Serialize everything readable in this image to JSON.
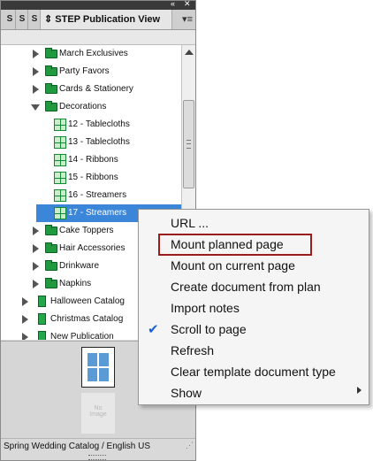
{
  "panel": {
    "mini_tabs": [
      "S",
      "S",
      "S"
    ],
    "title": "STEP Publication View",
    "title_prefix_icon": "sort-icon",
    "menu_icon": "panel-menu-icon",
    "collapse_icon": "double-arrow-icon",
    "close_icon": "close-icon"
  },
  "tree": {
    "items": [
      {
        "label": "March Exclusives",
        "icon": "folder-icon",
        "expander": "closed"
      },
      {
        "label": "Party Favors",
        "icon": "folder-icon",
        "expander": "closed"
      },
      {
        "label": "Cards & Stationery",
        "icon": "folder-icon",
        "expander": "closed"
      },
      {
        "label": "Decorations",
        "icon": "folder-icon",
        "expander": "open"
      },
      {
        "label": "12 - Tablecloths",
        "icon": "page-icon"
      },
      {
        "label": "13 - Tablecloths",
        "icon": "page-icon"
      },
      {
        "label": "14 - Ribbons",
        "icon": "page-icon"
      },
      {
        "label": "15 - Ribbons",
        "icon": "page-icon"
      },
      {
        "label": "16 - Streamers",
        "icon": "page-icon"
      },
      {
        "label": "17 - Streamers",
        "icon": "page-icon",
        "selected": true
      },
      {
        "label": "Cake Toppers",
        "icon": "folder-icon",
        "expander": "closed"
      },
      {
        "label": "Hair Accessories",
        "icon": "folder-icon",
        "expander": "closed"
      },
      {
        "label": "Drinkware",
        "icon": "folder-icon",
        "expander": "closed"
      },
      {
        "label": "Napkins",
        "icon": "folder-icon",
        "expander": "closed"
      },
      {
        "label": "Halloween Catalog",
        "icon": "document-icon",
        "expander": "closed"
      },
      {
        "label": "Christmas Catalog",
        "icon": "document-icon",
        "expander": "closed"
      },
      {
        "label": "New Publication",
        "icon": "document-icon",
        "expander": "closed"
      }
    ]
  },
  "preview": {
    "no_image_line1": "No",
    "no_image_line2": "Image"
  },
  "status": {
    "text": "Spring Wedding Catalog / English US"
  },
  "context_menu": {
    "items": [
      {
        "label": "URL ..."
      },
      {
        "label": "Mount planned page",
        "highlighted": true
      },
      {
        "label": "Mount on current page"
      },
      {
        "label": "Create document from plan"
      },
      {
        "label": "Import notes"
      },
      {
        "label": "Scroll to page",
        "checked": true
      },
      {
        "label": "Refresh"
      },
      {
        "label": "Clear template document type"
      },
      {
        "label": "Show",
        "has_submenu": true
      }
    ]
  },
  "colors": {
    "selection": "#3b86d8",
    "folder": "#1f9a3e",
    "highlight_border": "#9b1c1c",
    "check": "#1c5fd2"
  }
}
